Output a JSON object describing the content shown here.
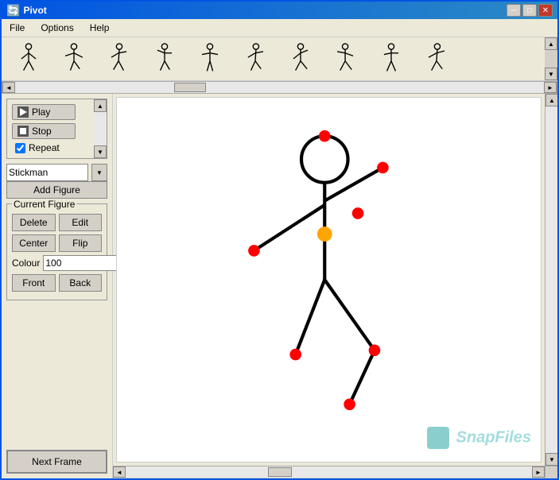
{
  "window": {
    "title": "Pivot",
    "icon": "🔄"
  },
  "title_buttons": {
    "minimize": "─",
    "maximize": "□",
    "close": "✕"
  },
  "menu": {
    "items": [
      "File",
      "Options",
      "Help"
    ]
  },
  "toolbar": {
    "stickmen": [
      {
        "id": 1,
        "label": "stickman-1"
      },
      {
        "id": 2,
        "label": "stickman-2"
      },
      {
        "id": 3,
        "label": "stickman-3"
      },
      {
        "id": 4,
        "label": "stickman-4"
      },
      {
        "id": 5,
        "label": "stickman-5"
      },
      {
        "id": 6,
        "label": "stickman-6"
      },
      {
        "id": 7,
        "label": "stickman-7"
      },
      {
        "id": 8,
        "label": "stickman-8"
      },
      {
        "id": 9,
        "label": "stickman-9"
      },
      {
        "id": 10,
        "label": "stickman-10"
      }
    ]
  },
  "playback": {
    "play_label": "Play",
    "stop_label": "Stop",
    "repeat_label": "Repeat",
    "repeat_checked": true
  },
  "figure_select": {
    "current": "Stickman",
    "options": [
      "Stickman"
    ],
    "add_label": "Add Figure"
  },
  "current_figure": {
    "group_label": "Current Figure",
    "delete_label": "Delete",
    "edit_label": "Edit",
    "center_label": "Center",
    "flip_label": "Flip",
    "colour_label": "Colour",
    "colour_value": "100",
    "front_label": "Front",
    "back_label": "Back"
  },
  "next_frame": {
    "label": "Next Frame"
  },
  "watermark": {
    "text": "SnapFiles"
  }
}
